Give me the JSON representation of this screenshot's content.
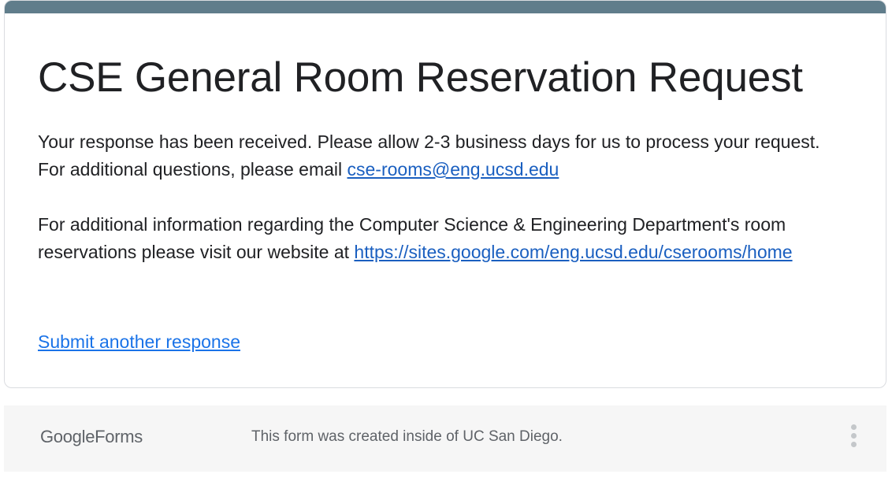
{
  "form": {
    "title": "CSE General Room Reservation Request",
    "message_1_text": "Your response has been received. Please allow 2-3 business days for us to process your request. For additional questions, please email ",
    "message_1_email": "cse-rooms@eng.ucsd.edu",
    "message_2_text": "For additional information regarding the Computer Science & Engineering Department's room reservations please visit our website at ",
    "message_2_url": "https://sites.google.com/eng.ucsd.edu/cserooms/home",
    "submit_another_label": "Submit another response",
    "accent_color": "#607d8b",
    "link_color": "#1a73e8"
  },
  "footer": {
    "logo_google": "Google",
    "logo_forms": "Forms",
    "note": "This form was created inside of UC San Diego.",
    "menu_icon": "more-vert-icon"
  }
}
